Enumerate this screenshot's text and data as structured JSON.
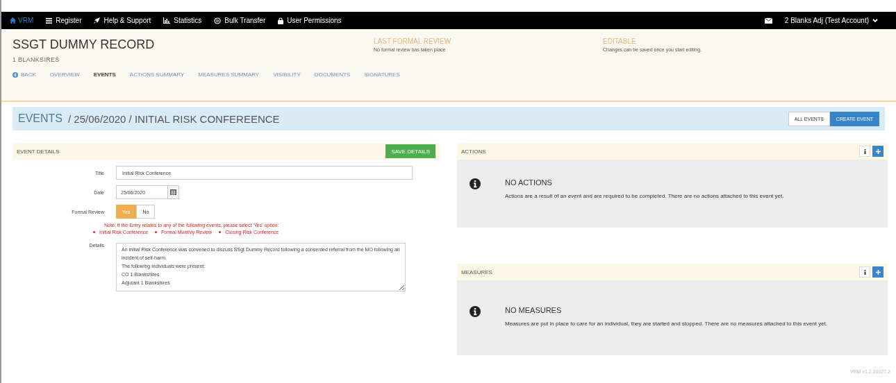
{
  "topbar": {
    "brand": "VRM",
    "items": [
      {
        "kind": "menu",
        "label": "Register"
      },
      {
        "kind": "rocket",
        "label": "Help & Support"
      },
      {
        "kind": "chart",
        "label": "Statistics"
      },
      {
        "kind": "transfer",
        "label": "Bulk Transfer"
      },
      {
        "kind": "lock",
        "label": "User Permissions"
      }
    ],
    "user": "2 Blanks Adj (Test Account)"
  },
  "record": {
    "title": "SSGT DUMMY RECORD",
    "subtitle": "1 BLANKSIRES"
  },
  "status": [
    {
      "heading": "LAST FORMAL REVIEW",
      "text": "No formal review has taken place"
    },
    {
      "heading": "EDITABLE",
      "text": "Changes can be saved once you start editing."
    }
  ],
  "tabs": [
    {
      "label": "BACK",
      "kind": "back",
      "selected": false
    },
    {
      "label": "OVERVIEW",
      "kind": "tab",
      "selected": false
    },
    {
      "label": "EVENTS",
      "kind": "tab",
      "selected": true
    },
    {
      "label": "ACTIONS SUMMARY",
      "kind": "tab",
      "selected": false
    },
    {
      "label": "MEASURES SUMMARY",
      "kind": "tab",
      "selected": false
    },
    {
      "label": "VISIBILITY",
      "kind": "tab",
      "selected": false
    },
    {
      "label": "DOCUMENTS",
      "kind": "tab",
      "selected": false
    },
    {
      "label": "SIGNATURES",
      "kind": "tab",
      "selected": false
    }
  ],
  "breadcrumb": {
    "root": "EVENTS",
    "path": "/ 25/06/2020 / INITIAL RISK CONFEREENCE",
    "buttons": [
      {
        "label": "ALL EVENTS",
        "selected": false
      },
      {
        "label": "CREATE EVENT",
        "selected": true
      }
    ]
  },
  "event_details": {
    "heading": "EVENT DETAILS",
    "save": "SAVE DETAILS",
    "title_label": "Title",
    "title_value": "Initial Risk Conference",
    "date_label": "Date",
    "date_value": "25/06/2020",
    "review_label": "Formal Review",
    "review_options": [
      {
        "label": "Yes",
        "selected": true
      },
      {
        "label": "No",
        "selected": false
      }
    ],
    "note": "Note: If the Entry relates to any of the following events, please select 'Yes' option:",
    "note_items": [
      "Initial Risk Conference",
      "Formal Monthly Review",
      "Closing Risk Conference"
    ],
    "details_label": "Details",
    "details_value": "An initial Risk Conference was convened to discuss SSgt Dummy Record following a consented referral from the MO following an incident of self-harm.\nThe following individuals were present:\nCO 1 Blankshires\nAdjutant 1 Blankshires"
  },
  "panels": [
    {
      "heading": "ACTIONS",
      "empty_title": "NO ACTIONS",
      "empty_text": "Actions are a result of an event and are required to be completed. There are no actions attached to this event yet."
    },
    {
      "heading": "MEASURES",
      "empty_title": "NO MEASURES",
      "empty_text": "Measures are put in place to care for an individual, they are started and stopped. There are no measures attached to this event yet."
    }
  ],
  "version": "VRM v1.2.20027.2"
}
